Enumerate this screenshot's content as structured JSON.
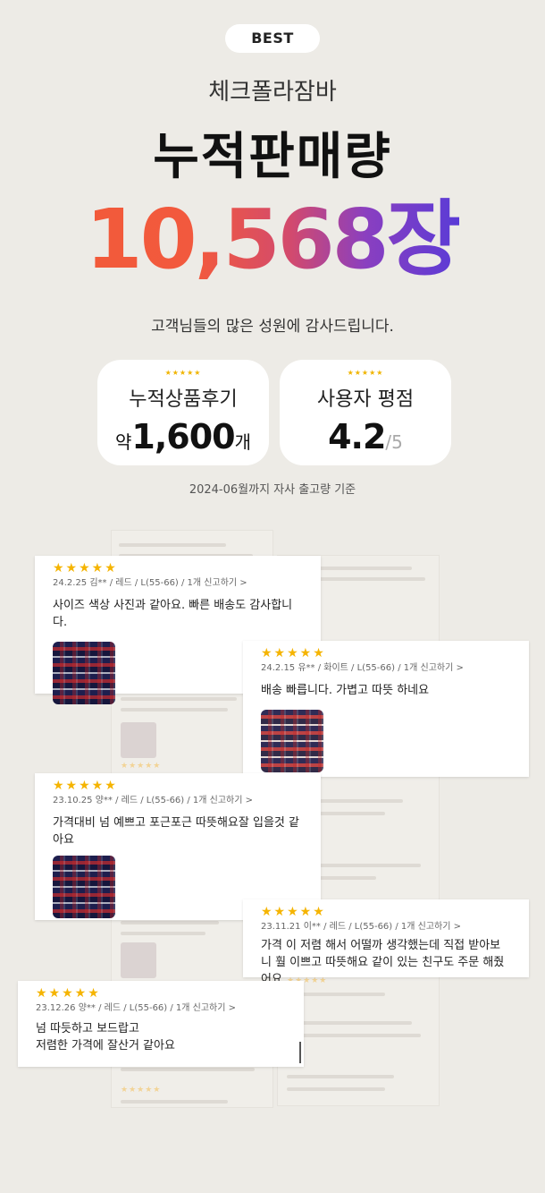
{
  "badge": "BEST",
  "product_name": "체크폴라잠바",
  "headline": "누적판매량",
  "total_sales": "10,568장",
  "thanks": "고객님들의 많은 성원에 감사드립니다.",
  "stats": {
    "reviews": {
      "stars": "★★★★★",
      "label": "누적상품후기",
      "prefix": "약",
      "value": "1,600",
      "suffix": "개"
    },
    "rating": {
      "stars": "★★★★★",
      "label": "사용자 평점",
      "value": "4.2",
      "max": "/5"
    }
  },
  "basis": "2024-06월까지  자사 출고량 기준",
  "reviews": [
    {
      "stars": "★★★★★",
      "meta": "24.2.25 김**  / 레드 / L(55-66) / 1개    신고하기 >",
      "text": "사이즈 색상 사진과 같아요. 빠른 배송도 감사합니다."
    },
    {
      "stars": "★★★★★",
      "meta": "24.2.15 유**  / 화이트 / L(55-66) / 1개   신고하기 >",
      "text": "배송 빠릅니다. 가볍고 따뜻 하네요"
    },
    {
      "stars": "★★★★★",
      "meta": "23.10.25 양**  / 레드 / L(55-66) / 1개    신고하기 >",
      "text": "가격대비 넘 예쁘고 포근포근 따뜻해요잘 입을것 같아요"
    },
    {
      "stars": "★★★★★",
      "meta": "23.11.21 이**  / 레드 / L(55-66) / 1개    신고하기 >",
      "text": "가격 이 저렴 해서 어떨까 생각했는데 직접 받아보니 훨 이쁘고 따뜻해요 같이 있는 친구도 주문 해줬어요"
    },
    {
      "stars": "★★★★★",
      "meta": "23.12.26 양**  / 레드 / L(55-66) / 1개    신고하기 >",
      "text_line1": "넘 따듯하고 보드랍고",
      "text_line2": "저렴한 가격에 잘산거 같아요"
    }
  ]
}
